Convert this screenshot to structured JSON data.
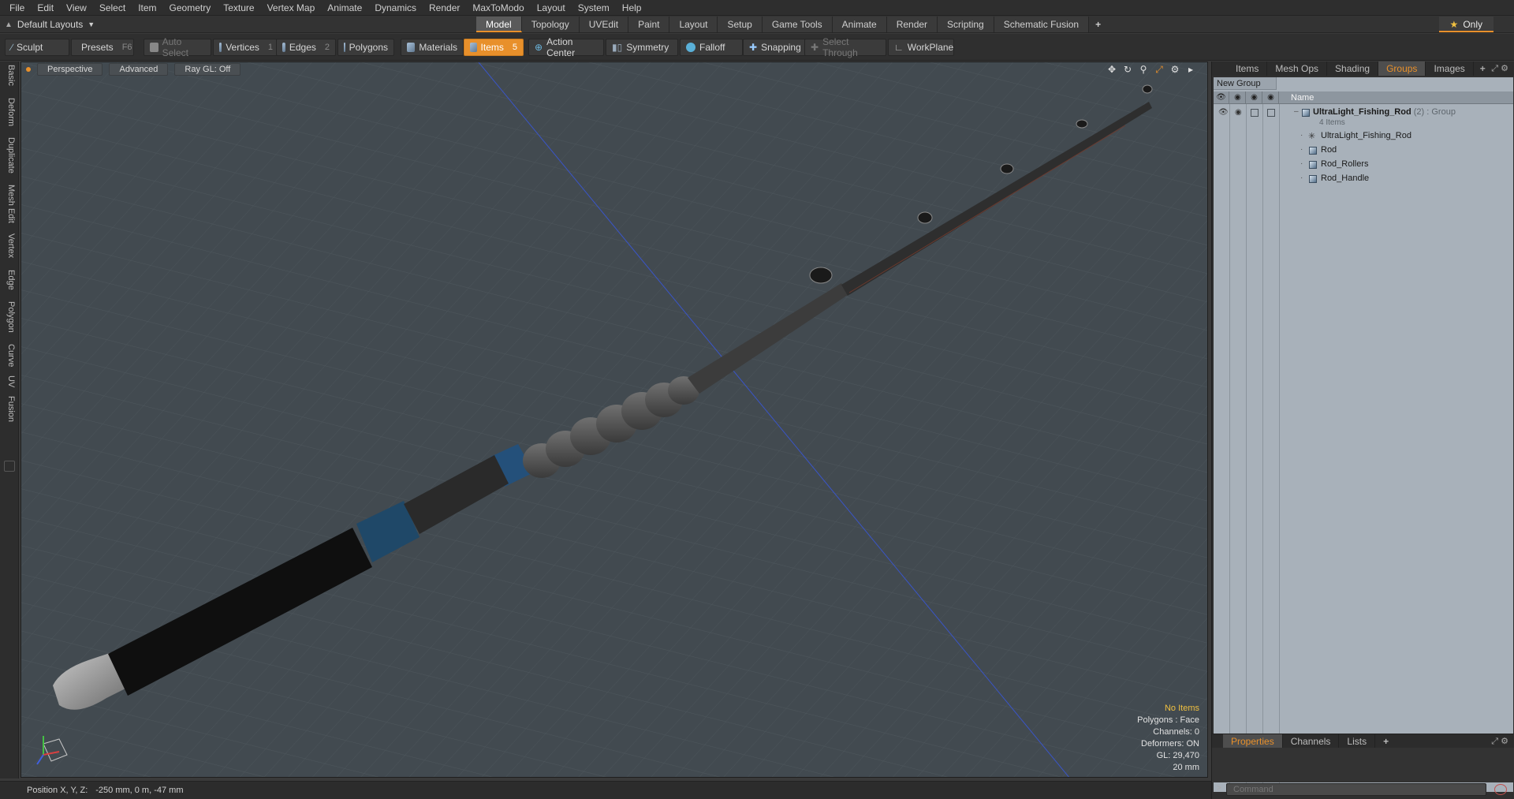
{
  "menu": [
    "File",
    "Edit",
    "View",
    "Select",
    "Item",
    "Geometry",
    "Texture",
    "Vertex Map",
    "Animate",
    "Dynamics",
    "Render",
    "MaxToModo",
    "Layout",
    "System",
    "Help"
  ],
  "layout_selector": "Default Layouts",
  "layout_tabs": [
    {
      "label": "Model",
      "active": true
    },
    {
      "label": "Topology",
      "active": false
    },
    {
      "label": "UVEdit",
      "active": false
    },
    {
      "label": "Paint",
      "active": false
    },
    {
      "label": "Layout",
      "active": false
    },
    {
      "label": "Setup",
      "active": false
    },
    {
      "label": "Game Tools",
      "active": false
    },
    {
      "label": "Animate",
      "active": false
    },
    {
      "label": "Render",
      "active": false
    },
    {
      "label": "Scripting",
      "active": false
    },
    {
      "label": "Schematic Fusion",
      "active": false
    }
  ],
  "only_button": "Only",
  "toolbar": {
    "sculpt": "Sculpt",
    "presets": "Presets",
    "presets_key": "F6",
    "auto_select": "Auto Select",
    "vertices": "Vertices",
    "vertices_key": "1",
    "edges": "Edges",
    "edges_key": "2",
    "polygons": "Polygons",
    "materials": "Materials",
    "items": "Items",
    "items_key": "5",
    "action_center": "Action Center",
    "symmetry": "Symmetry",
    "falloff": "Falloff",
    "snapping": "Snapping",
    "select_through": "Select Through",
    "workplane": "WorkPlane"
  },
  "left_tabs": [
    "Basic",
    "Deform",
    "Duplicate",
    "Mesh Edit",
    "Vertex",
    "Edge",
    "Polygon",
    "Curve",
    "UV",
    "Fusion"
  ],
  "viewport": {
    "view": "Perspective",
    "shading": "Advanced",
    "raygl": "Ray GL: Off",
    "info": {
      "selection": "No Items",
      "polygons": "Polygons : Face",
      "channels": "Channels: 0",
      "deformers": "Deformers: ON",
      "gl": "GL: 29,470",
      "scale": "20 mm"
    },
    "colors": {
      "background": "#424a50",
      "grid": "#4c555b",
      "axis_line": "#3a55c8",
      "selection": "#e8902b"
    }
  },
  "status": {
    "label": "Position X, Y, Z:",
    "value": "-250 mm, 0 m, -47 mm"
  },
  "right_panel": {
    "tabs": [
      {
        "label": "Items",
        "active": false
      },
      {
        "label": "Mesh Ops",
        "active": false
      },
      {
        "label": "Shading",
        "active": false
      },
      {
        "label": "Groups",
        "active": true
      },
      {
        "label": "Images",
        "active": false
      }
    ],
    "new_group": "New Group",
    "name_column": "Name",
    "group": {
      "name": "UltraLight_Fishing_Rod",
      "count": "(2)",
      "type": ": Group",
      "subtitle": "4 Items"
    },
    "children": [
      {
        "name": "UltraLight_Fishing_Rod",
        "icon": "locator-icon"
      },
      {
        "name": "Rod",
        "icon": "mesh-icon"
      },
      {
        "name": "Rod_Rollers",
        "icon": "mesh-icon"
      },
      {
        "name": "Rod_Handle",
        "icon": "mesh-icon"
      }
    ],
    "bottom_tabs": [
      {
        "label": "Properties",
        "active": true
      },
      {
        "label": "Channels",
        "active": false
      },
      {
        "label": "Lists",
        "active": false
      }
    ],
    "command_placeholder": "Command"
  }
}
